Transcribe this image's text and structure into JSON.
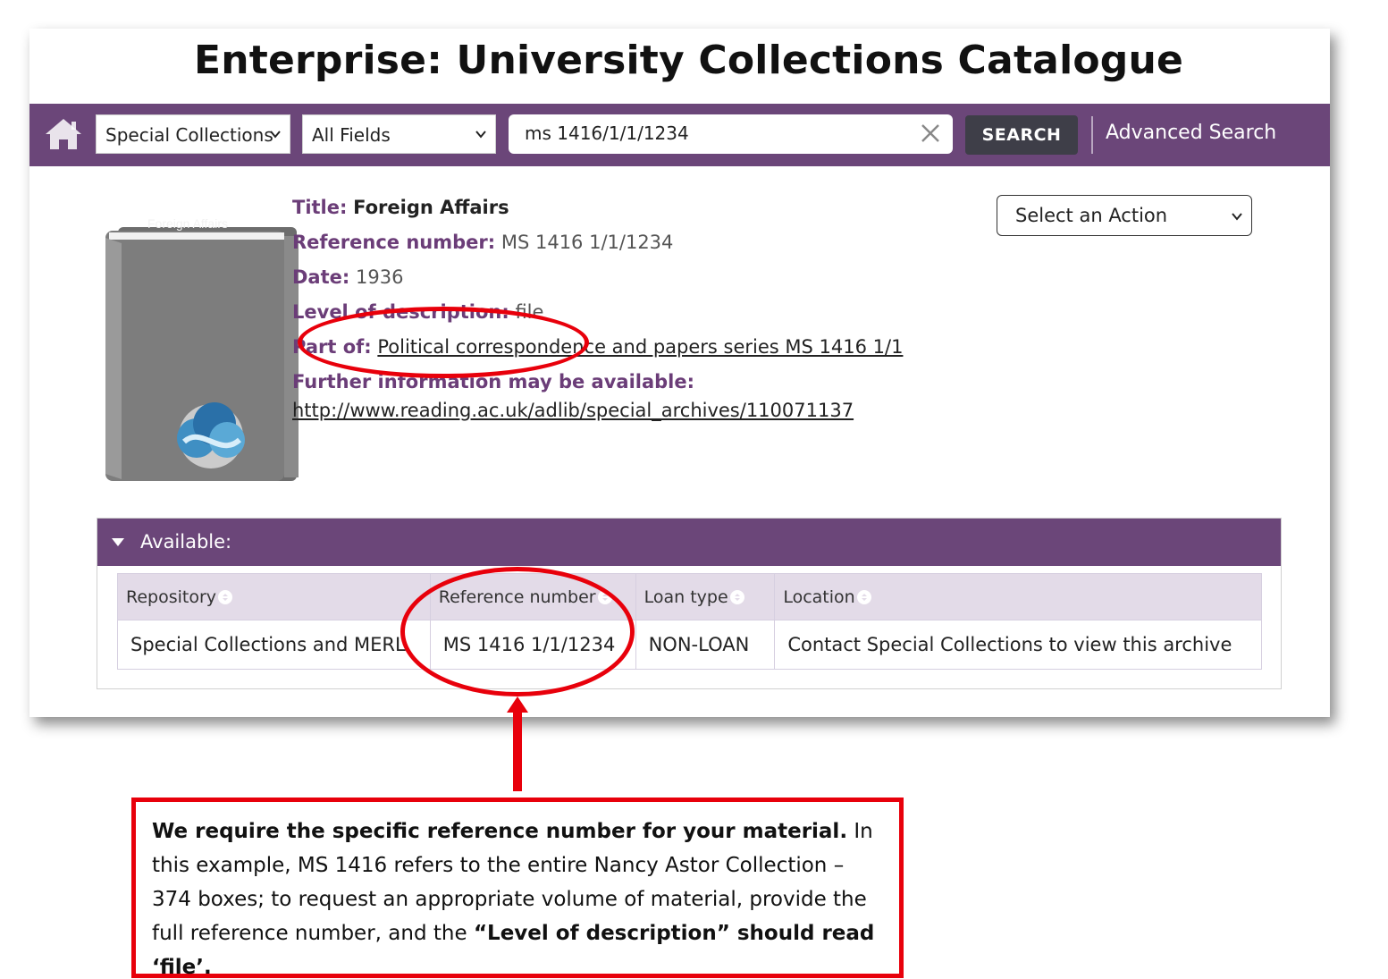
{
  "app": {
    "title": "Enterprise: University Collections Catalogue"
  },
  "navbar": {
    "scope_select": "Special Collections",
    "field_select": "All Fields",
    "search_value": "ms 1416/1/1/1234",
    "search_button": "SEARCH",
    "advanced_search": "Advanced Search",
    "colors": {
      "bar": "#6b4679",
      "button": "#3e3e48"
    }
  },
  "record": {
    "cover_title": "Foreign Affairs",
    "title_label": "Title:",
    "title_value": "Foreign Affairs",
    "ref_label": "Reference number:",
    "ref_value": "MS 1416 1/1/1234",
    "date_label": "Date:",
    "date_value": "1936",
    "level_label": "Level of description:",
    "level_value": "file",
    "partof_label": "Part of:",
    "partof_value": "Political correspondence and papers series MS 1416 1/1",
    "further_label": "Further information may be available:",
    "further_link": "http://www.reading.ac.uk/adlib/special_archives/110071137",
    "action_select": "Select an Action"
  },
  "available": {
    "heading": "Available:",
    "columns": [
      "Repository",
      "Reference number",
      "Loan type",
      "Location"
    ],
    "rows": [
      [
        "Special Collections and MERL",
        "MS 1416 1/1/1234",
        "NON-LOAN",
        "Contact Special Collections to view this archive"
      ]
    ]
  },
  "note": {
    "bold_lead": "We require the specific reference number for your material.",
    "body": " In this example, MS 1416 refers to the entire Nancy Astor Collection – 374 boxes; to request an appropriate volume of material, provide the full reference number, and the ",
    "bold_tail": "“Level of description” should read ‘file’."
  },
  "annotation_color": "#e8000b"
}
